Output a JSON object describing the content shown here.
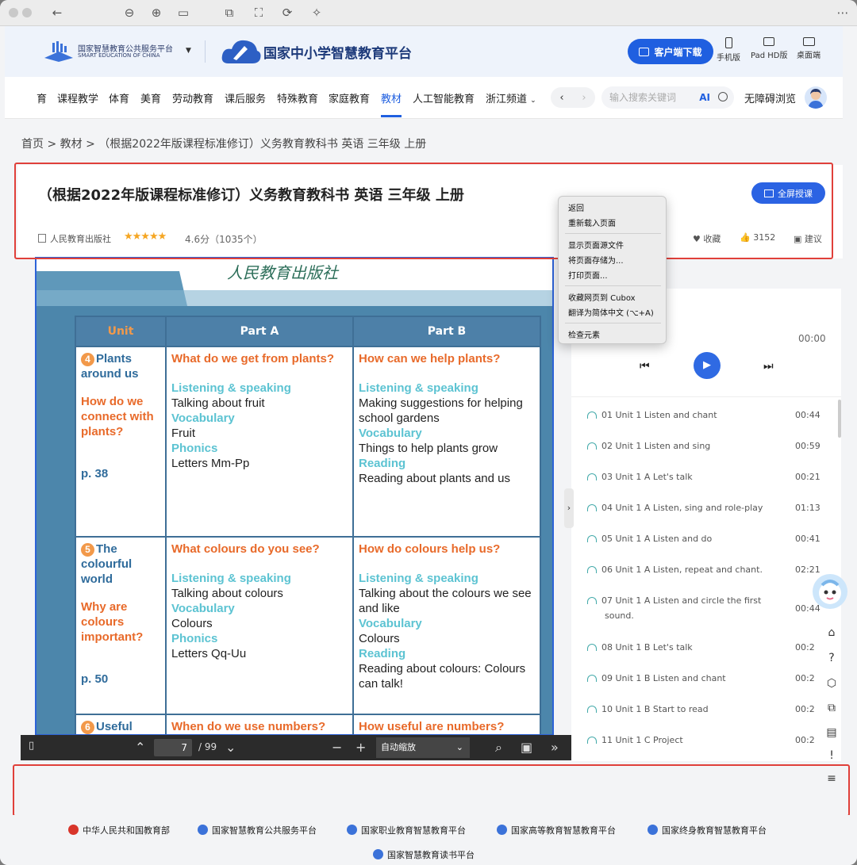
{
  "header": {
    "platform_cn": "国家智慧教育公共服务平台",
    "platform_en": "SMART EDUCATION OF CHINA",
    "site_title": "国家中小学智慧教育平台",
    "download": "客户端下载",
    "devices": [
      "手机版",
      "Pad HD版",
      "桌面端"
    ]
  },
  "nav": {
    "items": [
      "育",
      "课程教学",
      "体育",
      "美育",
      "劳动教育",
      "课后服务",
      "特殊教育",
      "家庭教育",
      "教材",
      "人工智能教育",
      "浙江频道"
    ],
    "search_placeholder": "输入搜索关键词",
    "ai": "AI",
    "accessibility": "无障碍浏览"
  },
  "breadcrumb": [
    "首页",
    ">",
    "教材",
    ">",
    "（根据2022年版课程标准修订）义务教育教科书 英语 三年级 上册"
  ],
  "book": {
    "title": "（根据2022年版课程标准修订）义务教育教科书 英语 三年级 上册",
    "fullscreen": "全屏授课",
    "publisher": "人民教育出版社",
    "stars": "★★★★★",
    "rating": "4.6分（1035个）",
    "favorite": "收藏",
    "likes": "3152",
    "suggest": "建议"
  },
  "page": {
    "script": "人民教育出版社",
    "headers": [
      "Unit",
      "Part A",
      "Part B"
    ],
    "rows": [
      {
        "num": "4",
        "unit": "Plants around us",
        "question": "How do we connect with plants?",
        "pageref": "p. 38",
        "a_q": "What do we get from plants?",
        "a_ls": "Listening & speaking",
        "a_ls_t": "Talking about fruit",
        "a_v": "Vocabulary",
        "a_v_t": "Fruit",
        "a_p": "Phonics",
        "a_p_t": "Letters Mm-Pp",
        "b_q": "How can we help plants?",
        "b_ls": "Listening & speaking",
        "b_ls_t": "Making suggestions for helping school gardens",
        "b_v": "Vocabulary",
        "b_v_t": "Things to help plants grow",
        "b_r": "Reading",
        "b_r_t": "Reading about plants and us"
      },
      {
        "num": "5",
        "unit": "The colourful world",
        "question": "Why are colours important?",
        "pageref": "p. 50",
        "a_q": "What colours do you see?",
        "a_ls": "Listening & speaking",
        "a_ls_t": "Talking about colours",
        "a_v": "Vocabulary",
        "a_v_t": "Colours",
        "a_p": "Phonics",
        "a_p_t": "Letters Qq-Uu",
        "b_q": "How do colours help us?",
        "b_ls": "Listening & speaking",
        "b_ls_t": "Talking about the colours we see and like",
        "b_v": "Vocabulary",
        "b_v_t": "Colours",
        "b_r": "Reading",
        "b_r_t": "Reading about colours: Colours can talk!"
      },
      {
        "num": "6",
        "unit": "Useful",
        "a_q": "When do we use numbers?",
        "b_q": "How useful are numbers?"
      }
    ]
  },
  "viewer": {
    "page": "7",
    "total": "/ 99",
    "zoom": "自动缩放"
  },
  "player": {
    "time": "00:00",
    "tracks": [
      {
        "t": "01 Unit 1 Listen and chant",
        "d": "00:44"
      },
      {
        "t": "02 Unit 1 Listen and sing",
        "d": "00:59"
      },
      {
        "t": "03 Unit 1 A Let's talk",
        "d": "00:21"
      },
      {
        "t": "04 Unit 1 A Listen, sing and role-play",
        "d": "01:13"
      },
      {
        "t": "05 Unit 1 A Listen and do",
        "d": "00:41"
      },
      {
        "t": "06 Unit 1 A Listen, repeat and chant.",
        "d": "02:21"
      },
      {
        "t": "07 Unit 1 A Listen and circle the first",
        "t2": "sound.",
        "d": "00:44"
      },
      {
        "t": "08 Unit 1 B Let's talk",
        "d": "00:2"
      },
      {
        "t": "09 Unit 1 B Listen and chant",
        "d": "00:2"
      },
      {
        "t": "10 Unit 1 B Start to read",
        "d": "00:2"
      },
      {
        "t": "11 Unit 1 C Project",
        "d": "00:2"
      }
    ]
  },
  "context_menu": [
    "返回",
    "重新载入页面",
    "显示页面源文件",
    "将页面存储为...",
    "打印页面...",
    "收藏网页到 Cubox",
    "翻译为简体中文 (⌥+A)",
    "检查元素"
  ],
  "footer": [
    "中华人民共和国教育部",
    "国家智慧教育公共服务平台",
    "国家职业教育智慧教育平台",
    "国家高等教育智慧教育平台",
    "国家终身教育智慧教育平台",
    "国家智慧教育读书平台"
  ],
  "colors": {
    "accent": "#1f5fe0",
    "annotation": "#e0403a",
    "viewer_border": "#2d63d8"
  }
}
